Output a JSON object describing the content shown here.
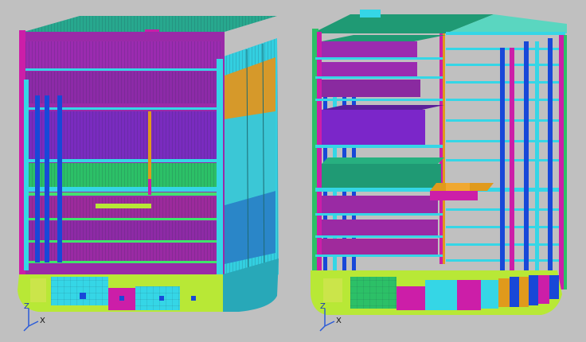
{
  "background": "#c0c0c0",
  "colors": {
    "magenta": "#cc1ea8",
    "purple": "#8a2a9a",
    "violet": "#7b26c9",
    "teal": "#1f9a8a",
    "green": "#2fbf5a",
    "cyan": "#35d6e6",
    "blue": "#1848d8",
    "yellowGreen": "#b8e836",
    "orange": "#e09a1c",
    "mesh": "#24324a"
  },
  "views": [
    {
      "id": "left-model",
      "label": "full-mesh-view",
      "triad": {
        "z": "Z",
        "x": "X"
      }
    },
    {
      "id": "right-model",
      "label": "structural-members-view",
      "triad": {
        "z": "Z",
        "x": "X"
      }
    }
  ]
}
